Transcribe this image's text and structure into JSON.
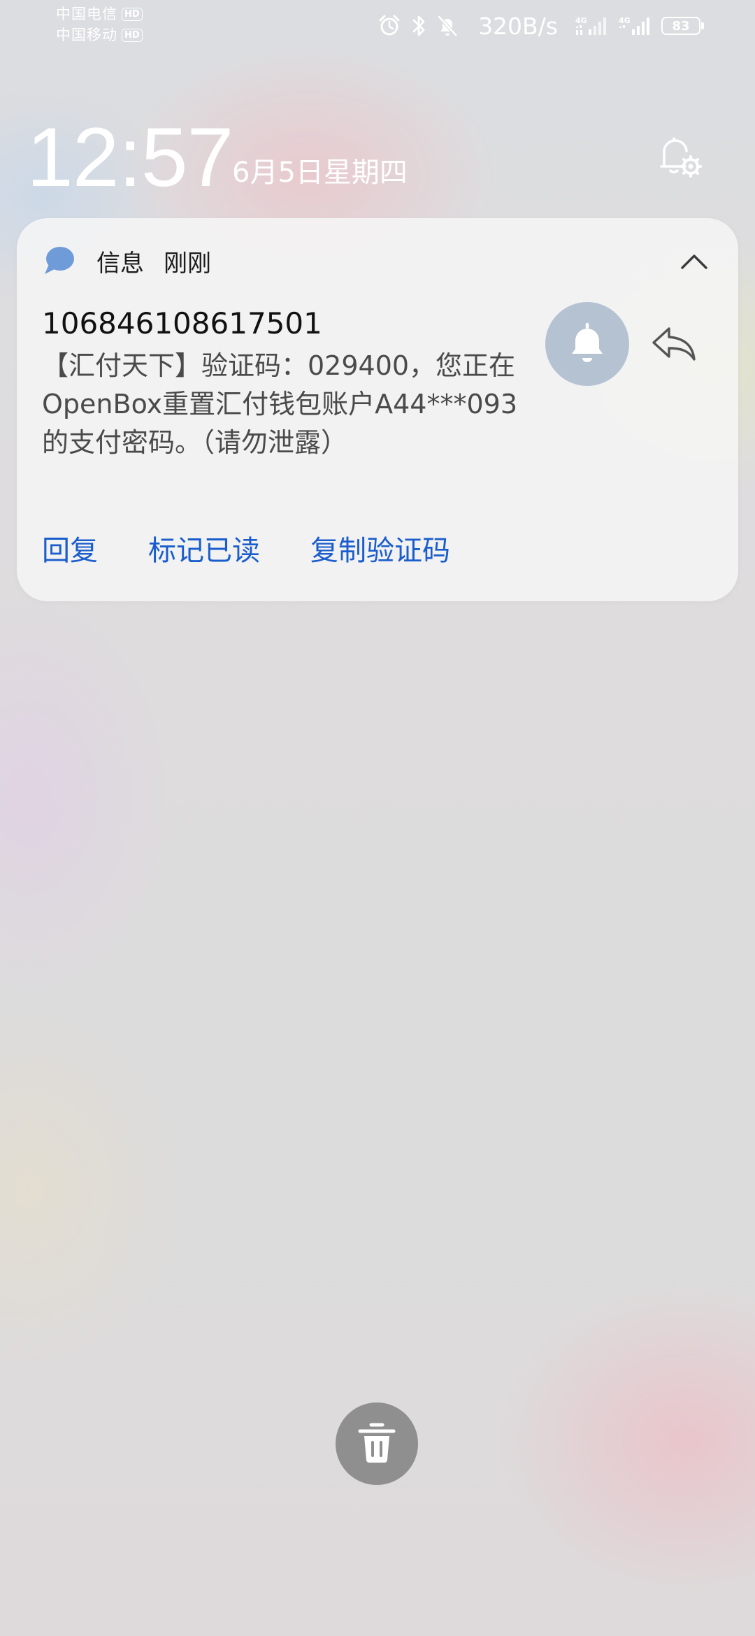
{
  "status_bar": {
    "carriers": [
      {
        "name": "中国电信",
        "badge": "HD"
      },
      {
        "name": "中国移动",
        "badge": "HD"
      }
    ],
    "icons": [
      "alarm-icon",
      "bluetooth-icon",
      "mute-bell-icon"
    ],
    "net_speed": "320B/s",
    "signals": [
      {
        "type": "4G",
        "icon": "signal-4g-icon"
      },
      {
        "type": "4G",
        "icon": "signal-4g-icon"
      }
    ],
    "battery_level": "83"
  },
  "lockscreen": {
    "time": "12:57",
    "date": "6月5日星期四"
  },
  "notification": {
    "app_name": "信息",
    "time": "刚刚",
    "sender": "106846108617501",
    "message": "【汇付天下】验证码：029400，您正在OpenBox重置汇付钱包账户A44***093的支付密码。（请勿泄露）",
    "actions": {
      "reply": "回复",
      "mark_read": "标记已读",
      "copy_code": "复制验证码"
    }
  },
  "colors": {
    "action_blue": "#1a5dcc",
    "app_icon_blue": "#6f9bd8",
    "bell_circle": "#b4c2d2",
    "clear_button": "#8f8f8f"
  }
}
